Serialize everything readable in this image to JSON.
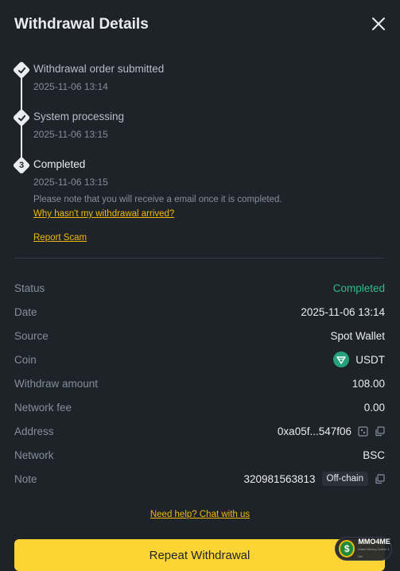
{
  "header": {
    "title": "Withdrawal Details"
  },
  "timeline": {
    "steps": [
      {
        "title": "Withdrawal order submitted",
        "time": "2025-11-06 13:14"
      },
      {
        "title": "System processing",
        "time": "2025-11-06 13:15"
      },
      {
        "title": "Completed",
        "time": "2025-11-06 13:15",
        "number": "3"
      }
    ],
    "note": "Please note that you will receive a email once it is completed.",
    "why_link": "Why hasn't my withdrawal arrived?",
    "report_link": "Report Scam"
  },
  "details": {
    "status_label": "Status",
    "status_value": "Completed",
    "date_label": "Date",
    "date_value": "2025-11-06 13:14",
    "source_label": "Source",
    "source_value": "Spot Wallet",
    "coin_label": "Coin",
    "coin_value": "USDT",
    "amount_label": "Withdraw amount",
    "amount_value": "108.00",
    "fee_label": "Network fee",
    "fee_value": "0.00",
    "address_label": "Address",
    "address_value": "0xa05f...547f06",
    "network_label": "Network",
    "network_value": "BSC",
    "note_label": "Note",
    "note_value": "320981563813",
    "note_tag": "Off-chain"
  },
  "help_link": "Need help? Chat with us",
  "primary_button": "Repeat Withdrawal",
  "watermark": {
    "symbol": "$",
    "name": "MMO4ME",
    "sub": "Make Money Online 4 Me"
  },
  "colors": {
    "background": "#1e2329",
    "accent": "#fcd535",
    "link": "#f0b90b",
    "success": "#2ebd85",
    "coin": "#26a17b"
  },
  "icons": [
    "close-icon",
    "check-icon",
    "coin-usdt-icon",
    "qr-code-icon",
    "copy-icon"
  ]
}
